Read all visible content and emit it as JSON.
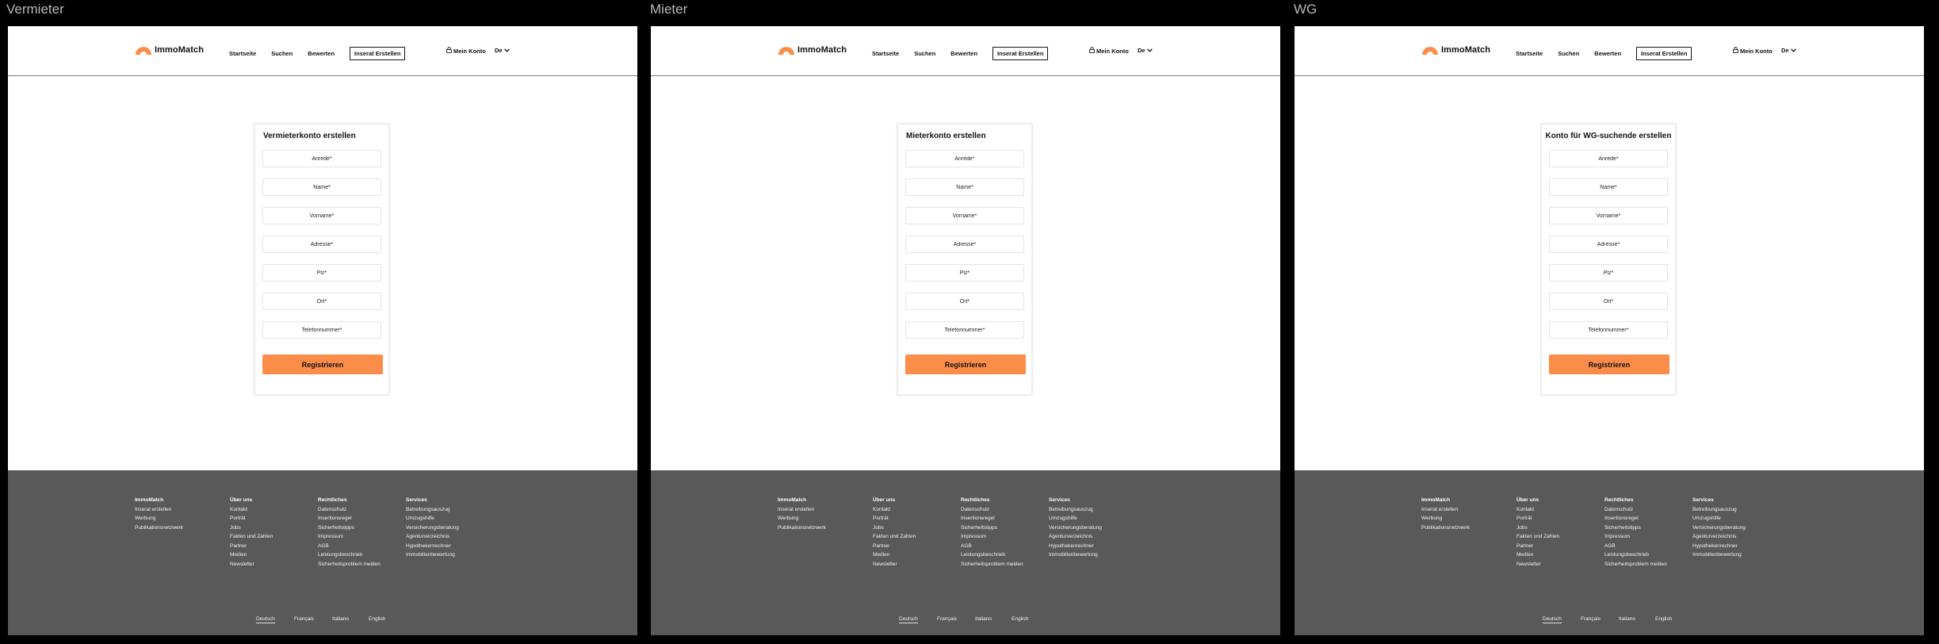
{
  "colors": {
    "accent": "#fb8c4a",
    "footer_bg": "#595959",
    "page_bg": "#000000"
  },
  "frame_labels": [
    "Vermieter",
    "Mieter",
    "WG"
  ],
  "header": {
    "logo_text": "ImmoMatch",
    "logo_icon": "sunrise-logo-icon",
    "nav": {
      "home": "Startseite",
      "search": "Suchen",
      "rate": "Bewerten",
      "create_listing": "Inserat Erstellen"
    },
    "account": "Mein Konto",
    "account_icon": "lock-icon",
    "language": "De",
    "language_icon": "chevron-down-icon"
  },
  "forms": {
    "landlord": {
      "title": "Vermieterkonto erstellen"
    },
    "tenant": {
      "title": "Mieterkonto erstellen"
    },
    "shared": {
      "title": "Konto für WG-suchende erstellen"
    },
    "fields": {
      "salutation": "Anrede*",
      "name": "Name*",
      "firstname": "Vorname*",
      "address": "Adresse*",
      "zip": "Plz*",
      "city": "Ort*",
      "phone": "Telefonnummer*"
    },
    "submit": "Registrieren"
  },
  "footer": {
    "col1": {
      "title": "ImmoMatch",
      "items": [
        "Inserat erstellen",
        "Werbung",
        "Publikationsnetzwerk"
      ]
    },
    "col2": {
      "title": "Über uns",
      "items": [
        "Kontakt",
        "Porträt",
        "Jobs",
        "Fakten und Zahlen",
        "Partner",
        "Medien",
        "Newsletter"
      ]
    },
    "col3": {
      "title": "Rechtliches",
      "items": [
        "Datenschutz",
        "Insertionsregel",
        "Sicherheitstipps",
        "Impressum",
        "AGB",
        "Leistungsbeschrieb",
        "Sicherheitsproblem melden"
      ]
    },
    "col4": {
      "title": "Services",
      "items": [
        "Betreibungsauszug",
        "Umzugshilfe",
        "Versicherungsberatung",
        "Agenturverzeichnis",
        "Hypothekenrechner",
        "Immobilienbewertung"
      ]
    },
    "languages": [
      "Deutsch",
      "Français",
      "Italiano",
      "English"
    ]
  }
}
